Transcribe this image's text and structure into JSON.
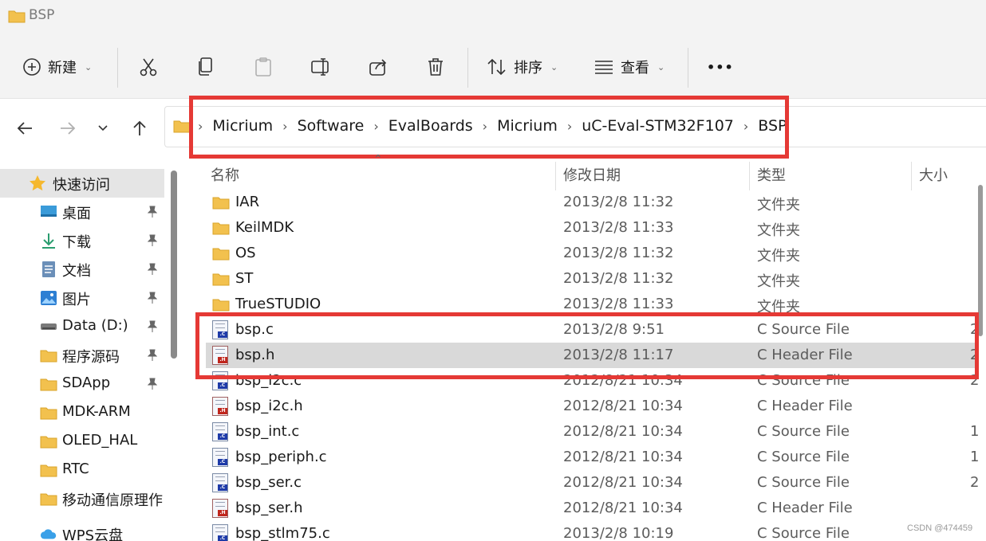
{
  "window": {
    "title": "BSP"
  },
  "toolbar": {
    "new_label": "新建",
    "sort_label": "排序",
    "view_label": "查看",
    "more_label": "•••"
  },
  "address": {
    "crumbs": [
      "Micrium",
      "Software",
      "EvalBoards",
      "Micrium",
      "uC-Eval-STM32F107",
      "BSP"
    ]
  },
  "sidebar": {
    "items": [
      {
        "label": "快速访问",
        "icon": "star-icon",
        "pinned": false
      },
      {
        "label": "桌面",
        "icon": "desktop-icon",
        "pinned": true
      },
      {
        "label": "下载",
        "icon": "download-icon",
        "pinned": true
      },
      {
        "label": "文档",
        "icon": "document-icon",
        "pinned": true
      },
      {
        "label": "图片",
        "icon": "picture-icon",
        "pinned": true
      },
      {
        "label": "Data (D:)",
        "icon": "drive-icon",
        "pinned": true
      },
      {
        "label": "程序源码",
        "icon": "folder-icon",
        "pinned": true
      },
      {
        "label": "SDApp",
        "icon": "folder-icon",
        "pinned": true
      },
      {
        "label": "MDK-ARM",
        "icon": "folder-icon",
        "pinned": false
      },
      {
        "label": "OLED_HAL",
        "icon": "folder-icon",
        "pinned": false
      },
      {
        "label": "RTC",
        "icon": "folder-icon",
        "pinned": false
      },
      {
        "label": "移动通信原理作",
        "icon": "folder-icon",
        "pinned": false
      },
      {
        "label": "WPS云盘",
        "icon": "cloud-icon",
        "pinned": false
      }
    ]
  },
  "list": {
    "columns": {
      "name": "名称",
      "modified": "修改日期",
      "type": "类型",
      "size": "大小"
    },
    "rows": [
      {
        "name": "IAR",
        "modified": "2013/2/8 11:32",
        "type": "文件夹",
        "size": "",
        "kind": "folder"
      },
      {
        "name": "KeilMDK",
        "modified": "2013/2/8 11:33",
        "type": "文件夹",
        "size": "",
        "kind": "folder"
      },
      {
        "name": "OS",
        "modified": "2013/2/8 11:32",
        "type": "文件夹",
        "size": "",
        "kind": "folder"
      },
      {
        "name": "ST",
        "modified": "2013/2/8 11:32",
        "type": "文件夹",
        "size": "",
        "kind": "folder"
      },
      {
        "name": "TrueSTUDIO",
        "modified": "2013/2/8 11:33",
        "type": "文件夹",
        "size": "",
        "kind": "folder"
      },
      {
        "name": "bsp.c",
        "modified": "2013/2/8 9:51",
        "type": "C Source File",
        "size": "2",
        "kind": "c"
      },
      {
        "name": "bsp.h",
        "modified": "2013/2/8 11:17",
        "type": "C Header File",
        "size": "2",
        "kind": "h"
      },
      {
        "name": "bsp_i2c.c",
        "modified": "2012/8/21 10:34",
        "type": "C Source File",
        "size": "2",
        "kind": "c"
      },
      {
        "name": "bsp_i2c.h",
        "modified": "2012/8/21 10:34",
        "type": "C Header File",
        "size": "",
        "kind": "h"
      },
      {
        "name": "bsp_int.c",
        "modified": "2012/8/21 10:34",
        "type": "C Source File",
        "size": "1",
        "kind": "c"
      },
      {
        "name": "bsp_periph.c",
        "modified": "2012/8/21 10:34",
        "type": "C Source File",
        "size": "1",
        "kind": "c"
      },
      {
        "name": "bsp_ser.c",
        "modified": "2012/8/21 10:34",
        "type": "C Source File",
        "size": "2",
        "kind": "c"
      },
      {
        "name": "bsp_ser.h",
        "modified": "2012/8/21 10:34",
        "type": "C Header File",
        "size": "",
        "kind": "h"
      },
      {
        "name": "bsp_stlm75.c",
        "modified": "2013/2/8 10:19",
        "type": "C Source File",
        "size": "",
        "kind": "c"
      }
    ]
  },
  "watermark": "CSDN @474459",
  "colors": {
    "highlight_box": "#e53935",
    "selected_row": "#d9d9d9",
    "folder": "#f2c14e"
  }
}
